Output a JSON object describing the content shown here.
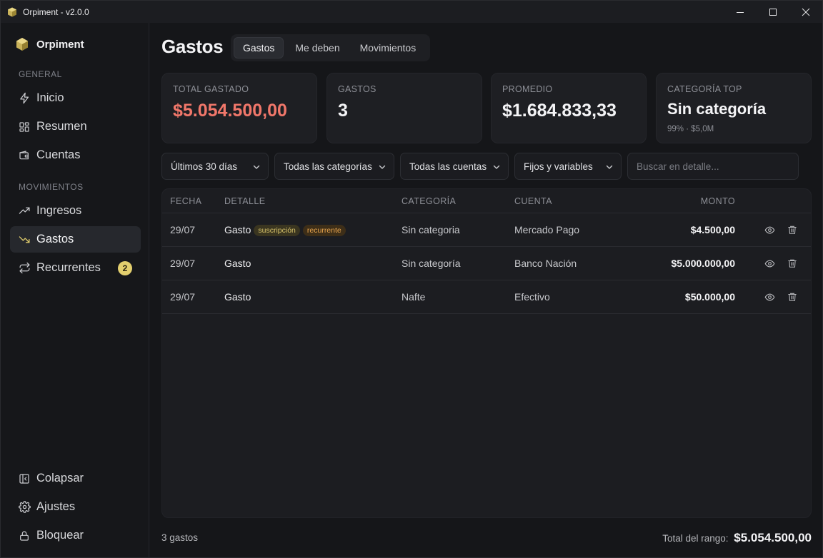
{
  "window": {
    "title": "Orpiment - v2.0.0"
  },
  "sidebar": {
    "brand": "Orpiment",
    "sections": {
      "general": "GENERAL",
      "movimientos": "MOVIMIENTOS"
    },
    "items": [
      {
        "label": "Inicio",
        "icon": "lightning-icon"
      },
      {
        "label": "Resumen",
        "icon": "grid-icon"
      },
      {
        "label": "Cuentas",
        "icon": "wallet-icon"
      },
      {
        "label": "Ingresos",
        "icon": "trending-up-icon"
      },
      {
        "label": "Gastos",
        "icon": "trending-down-icon"
      },
      {
        "label": "Recurrentes",
        "icon": "repeat-icon",
        "badge": "2"
      }
    ],
    "bottom": [
      {
        "label": "Colapsar",
        "icon": "collapse-icon"
      },
      {
        "label": "Ajustes",
        "icon": "gear-icon"
      },
      {
        "label": "Bloquear",
        "icon": "lock-icon"
      }
    ]
  },
  "header": {
    "title": "Gastos",
    "tabs": [
      {
        "label": "Gastos"
      },
      {
        "label": "Me deben"
      },
      {
        "label": "Movimientos"
      }
    ]
  },
  "stats": [
    {
      "label": "TOTAL GASTADO",
      "value": "$5.054.500,00"
    },
    {
      "label": "GASTOS",
      "value": "3"
    },
    {
      "label": "PROMEDIO",
      "value": "$1.684.833,33"
    },
    {
      "label": "CATEGORÍA TOP",
      "value": "Sin categoría",
      "sub": "99% · $5,0M"
    }
  ],
  "filters": {
    "period": "Últimos 30 días",
    "category": "Todas las categorías",
    "account": "Todas las cuentas",
    "type": "Fijos y variables",
    "search_placeholder": "Buscar en detalle..."
  },
  "table": {
    "columns": {
      "fecha": "FECHA",
      "detalle": "DETALLE",
      "categoria": "CATEGORÍA",
      "cuenta": "CUENTA",
      "monto": "MONTO"
    },
    "rows": [
      {
        "fecha": "29/07",
        "detalle": "Gasto",
        "tags": [
          "suscripción",
          "recurrente"
        ],
        "categoria": "Sin categoria",
        "cuenta": "Mercado Pago",
        "monto": "$4.500,00"
      },
      {
        "fecha": "29/07",
        "detalle": "Gasto",
        "tags": [],
        "categoria": "Sin categoría",
        "cuenta": "Banco Nación",
        "monto": "$5.000.000,00"
      },
      {
        "fecha": "29/07",
        "detalle": "Gasto",
        "tags": [],
        "categoria": "Nafte",
        "cuenta": "Efectivo",
        "monto": "$50.000,00"
      }
    ]
  },
  "footer": {
    "count": "3 gastos",
    "total_label": "Total del rango:",
    "total_value": "$5.054.500,00"
  },
  "colors": {
    "accent_red": "#f1776a",
    "badge_yellow": "#e3cf6e",
    "tag_suscripcion": "#d8c36a",
    "tag_recurrente": "#e8a54e"
  }
}
